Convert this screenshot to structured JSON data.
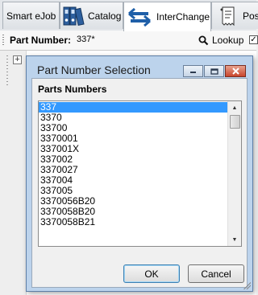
{
  "tabs": [
    {
      "label": "Smart eJob",
      "icon": "smart-ejob-icon",
      "active": false
    },
    {
      "label": "Catalog",
      "icon": "catalog-binders-icon",
      "active": false
    },
    {
      "label": "InterChange",
      "icon": "interchange-arrows-icon",
      "active": true
    },
    {
      "label": "Pos",
      "icon": "pos-receipt-icon",
      "active": false
    }
  ],
  "part_bar": {
    "label": "Part Number:",
    "value": "337*",
    "lookup_label": "Lookup",
    "lookup_icon": "magnifier-icon",
    "checkbox_checked": true
  },
  "dialog": {
    "title": "Part Number Selection",
    "group_label": "Parts Numbers",
    "items": [
      "337",
      "3370",
      "33700",
      "3370001",
      "337001X",
      "337002",
      "3370027",
      "337004",
      "337005",
      "3370056B20",
      "3370058B20",
      "3370058B21"
    ],
    "selected_item": "337",
    "ok_label": "OK",
    "cancel_label": "Cancel"
  },
  "colors": {
    "selection": "#3399ff",
    "dialog_frame": "#bcd3ec",
    "close_button": "#c8452c",
    "interchange_blue": "#1f5fa8"
  }
}
